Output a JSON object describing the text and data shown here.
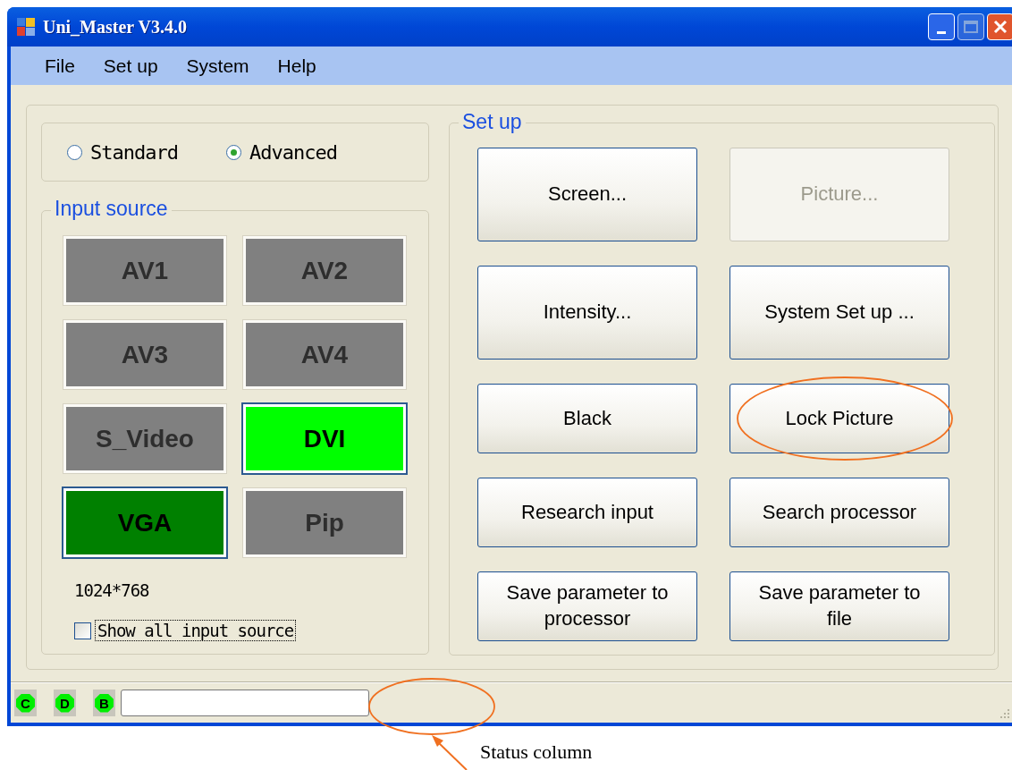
{
  "window": {
    "title": "Uni_Master V3.4.0"
  },
  "menu": [
    "File",
    "Set up",
    "System",
    "Help"
  ],
  "mode_options": [
    {
      "label": "Standard",
      "selected": false
    },
    {
      "label": "Advanced",
      "selected": true
    }
  ],
  "input_source": {
    "title": "Input source",
    "sources": [
      {
        "label": "AV1",
        "color": "#808080",
        "selected": false
      },
      {
        "label": "AV2",
        "color": "#808080",
        "selected": false
      },
      {
        "label": "AV3",
        "color": "#808080",
        "selected": false
      },
      {
        "label": "AV4",
        "color": "#808080",
        "selected": false
      },
      {
        "label": "S_Video",
        "color": "#808080",
        "selected": false
      },
      {
        "label": "DVI",
        "color": "#00ff00",
        "selected": true
      },
      {
        "label": "VGA",
        "color": "#008000",
        "selected": true
      },
      {
        "label": "Pip",
        "color": "#808080",
        "selected": false
      }
    ],
    "resolution": "1024*768",
    "show_all": {
      "label": "Show all input source",
      "checked": false
    }
  },
  "setup": {
    "title": "Set up",
    "buttons": [
      {
        "label": "Screen...",
        "disabled": false,
        "circled": false
      },
      {
        "label": "Picture...",
        "disabled": true,
        "circled": false
      },
      {
        "label": "Intensity...",
        "disabled": false,
        "circled": false
      },
      {
        "label": "System Set up ...",
        "disabled": false,
        "circled": false
      },
      {
        "label": "Black",
        "disabled": false,
        "circled": false
      },
      {
        "label": "Lock Picture",
        "disabled": false,
        "circled": true
      },
      {
        "label": "Research input",
        "disabled": false,
        "circled": false
      },
      {
        "label": "Search processor",
        "disabled": false,
        "circled": false
      },
      {
        "label": "Save parameter to processor",
        "disabled": false,
        "circled": false
      },
      {
        "label": "Save parameter to file",
        "disabled": false,
        "circled": false
      }
    ]
  },
  "status_bar": {
    "indicators": [
      "C",
      "D",
      "B"
    ]
  },
  "annotation": {
    "label": "Status column"
  }
}
